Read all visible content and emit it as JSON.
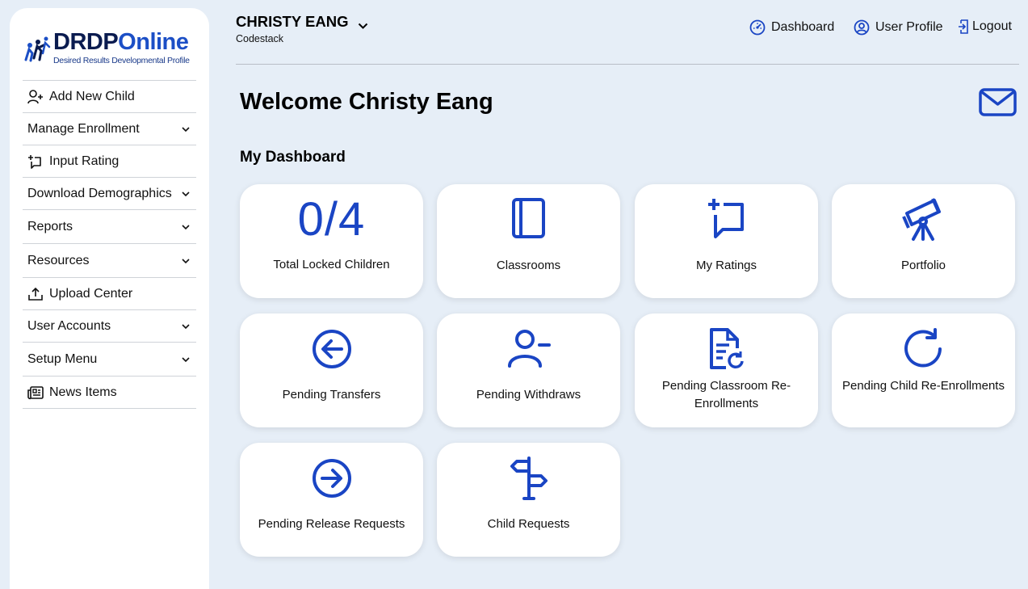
{
  "sidebar": {
    "logo": {
      "brand_dark": "DRDP",
      "brand_accent": "Online",
      "tagline": "Desired Results Developmental Profile"
    },
    "items": [
      {
        "label": "Add New Child",
        "icon": "add-user-icon"
      },
      {
        "label": "Manage Enrollment",
        "icon": "chevron-down-icon"
      },
      {
        "label": "Input Rating",
        "icon": "rating-icon"
      },
      {
        "label": "Download Demographics",
        "icon": "chevron-down-icon"
      },
      {
        "label": "Reports",
        "icon": "chevron-down-icon"
      },
      {
        "label": "Resources",
        "icon": "chevron-down-icon"
      },
      {
        "label": "Upload Center",
        "icon": "upload-icon"
      },
      {
        "label": "User Accounts",
        "icon": "chevron-down-icon"
      },
      {
        "label": "Setup Menu",
        "icon": "chevron-down-icon"
      },
      {
        "label": "News Items",
        "icon": "news-icon"
      }
    ]
  },
  "header": {
    "user_name": "CHRISTY EANG",
    "organization": "Codestack",
    "nav": {
      "dashboard": "Dashboard",
      "profile": "User Profile",
      "logout": "Logout"
    }
  },
  "main": {
    "welcome": "Welcome Christy Eang",
    "section_title": "My Dashboard",
    "locked_count": "0/4",
    "cards": [
      {
        "label": "Total Locked Children",
        "icon": "locked-count"
      },
      {
        "label": "Classrooms",
        "icon": "book-icon"
      },
      {
        "label": "My Ratings",
        "icon": "rating-icon"
      },
      {
        "label": "Portfolio",
        "icon": "telescope-icon"
      },
      {
        "label": "Pending Transfers",
        "icon": "arrow-left-circle-icon"
      },
      {
        "label": "Pending Withdraws",
        "icon": "user-minus-icon"
      },
      {
        "label": "Pending Classroom Re-Enrollments",
        "icon": "file-refresh-icon"
      },
      {
        "label": "Pending Child Re-Enrollments",
        "icon": "refresh-icon"
      },
      {
        "label": "Pending Release Requests",
        "icon": "arrow-right-circle-icon"
      },
      {
        "label": "Child Requests",
        "icon": "signpost-icon"
      }
    ]
  },
  "colors": {
    "background": "#e6eef7",
    "accent": "#1a45c4",
    "brand_dark": "#0a1b4f"
  }
}
